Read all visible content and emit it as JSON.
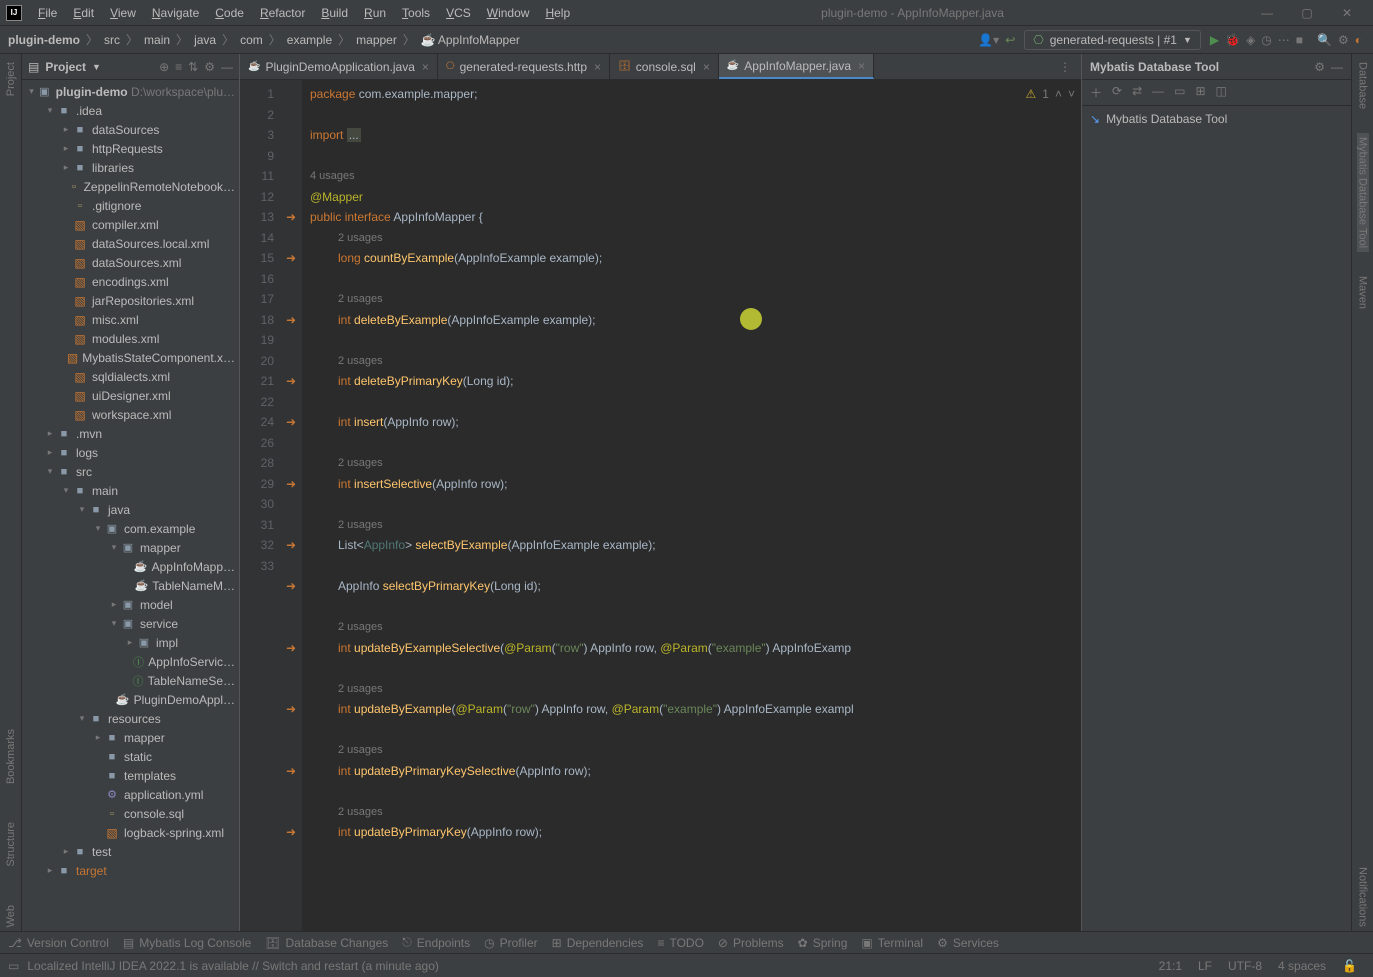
{
  "window": {
    "title": "plugin-demo - AppInfoMapper.java"
  },
  "menu": [
    "File",
    "Edit",
    "View",
    "Navigate",
    "Code",
    "Refactor",
    "Build",
    "Run",
    "Tools",
    "VCS",
    "Window",
    "Help"
  ],
  "breadcrumb": [
    "plugin-demo",
    "src",
    "main",
    "java",
    "com",
    "example",
    "mapper",
    "AppInfoMapper"
  ],
  "run_config": "generated-requests | #1",
  "project_panel": {
    "title": "Project"
  },
  "project": {
    "root": {
      "name": "plugin-demo",
      "path": "D:\\workspace\\plu…"
    },
    "nodes": [
      {
        "d": 1,
        "open": true,
        "ic": "folder",
        "name": ".idea"
      },
      {
        "d": 2,
        "open": false,
        "ic": "folder",
        "name": "dataSources"
      },
      {
        "d": 2,
        "open": false,
        "ic": "folder",
        "name": "httpRequests"
      },
      {
        "d": 2,
        "open": false,
        "ic": "folder",
        "name": "libraries"
      },
      {
        "d": 2,
        "ic": "file",
        "name": "ZeppelinRemoteNotebook…"
      },
      {
        "d": 2,
        "ic": "file",
        "name": ".gitignore"
      },
      {
        "d": 2,
        "ic": "xml",
        "name": "compiler.xml"
      },
      {
        "d": 2,
        "ic": "xml",
        "name": "dataSources.local.xml"
      },
      {
        "d": 2,
        "ic": "xml",
        "name": "dataSources.xml"
      },
      {
        "d": 2,
        "ic": "xml",
        "name": "encodings.xml"
      },
      {
        "d": 2,
        "ic": "xml",
        "name": "jarRepositories.xml"
      },
      {
        "d": 2,
        "ic": "xml",
        "name": "misc.xml"
      },
      {
        "d": 2,
        "ic": "xml",
        "name": "modules.xml"
      },
      {
        "d": 2,
        "ic": "xml",
        "name": "MybatisStateComponent.x…"
      },
      {
        "d": 2,
        "ic": "xml",
        "name": "sqldialects.xml"
      },
      {
        "d": 2,
        "ic": "xml",
        "name": "uiDesigner.xml"
      },
      {
        "d": 2,
        "ic": "xml",
        "name": "workspace.xml"
      },
      {
        "d": 1,
        "open": false,
        "ic": "folder",
        "name": ".mvn"
      },
      {
        "d": 1,
        "open": false,
        "ic": "folder",
        "name": "logs"
      },
      {
        "d": 1,
        "open": true,
        "ic": "folder",
        "name": "src"
      },
      {
        "d": 2,
        "open": true,
        "ic": "folder",
        "name": "main"
      },
      {
        "d": 3,
        "open": true,
        "ic": "folder",
        "name": "java"
      },
      {
        "d": 4,
        "open": true,
        "ic": "pkg",
        "name": "com.example"
      },
      {
        "d": 5,
        "open": true,
        "ic": "pkg",
        "name": "mapper"
      },
      {
        "d": 6,
        "ic": "java",
        "name": "AppInfoMapp…"
      },
      {
        "d": 6,
        "ic": "java",
        "name": "TableNameM…"
      },
      {
        "d": 5,
        "open": false,
        "ic": "pkg",
        "name": "model"
      },
      {
        "d": 5,
        "open": true,
        "ic": "pkg",
        "name": "service"
      },
      {
        "d": 6,
        "open": false,
        "ic": "pkg",
        "name": "impl"
      },
      {
        "d": 6,
        "ic": "class",
        "name": "AppInfoServic…"
      },
      {
        "d": 6,
        "ic": "class",
        "name": "TableNameSe…"
      },
      {
        "d": 5,
        "ic": "java",
        "name": "PluginDemoAppl…"
      },
      {
        "d": 3,
        "open": true,
        "ic": "folder",
        "name": "resources"
      },
      {
        "d": 4,
        "open": false,
        "ic": "folder",
        "name": "mapper"
      },
      {
        "d": 4,
        "ic": "folder",
        "name": "static"
      },
      {
        "d": 4,
        "ic": "folder",
        "name": "templates"
      },
      {
        "d": 4,
        "ic": "yml",
        "name": "application.yml"
      },
      {
        "d": 4,
        "ic": "file",
        "name": "console.sql"
      },
      {
        "d": 4,
        "ic": "xml",
        "name": "logback-spring.xml"
      },
      {
        "d": 2,
        "open": false,
        "ic": "folder",
        "name": "test"
      },
      {
        "d": 1,
        "open": false,
        "ic": "folder",
        "name": "target",
        "col": "#c57633"
      }
    ]
  },
  "tabs": [
    {
      "name": "PluginDemoApplication.java",
      "icon": "java"
    },
    {
      "name": "generated-requests.http",
      "icon": "http"
    },
    {
      "name": "console.sql",
      "icon": "sql"
    },
    {
      "name": "AppInfoMapper.java",
      "icon": "java",
      "active": true
    }
  ],
  "editor": {
    "warnings": "1",
    "line_numbers": [
      1,
      2,
      3,
      9,
      "",
      "",
      11,
      "",
      12,
      13,
      "",
      14,
      15,
      "",
      16,
      17,
      18,
      19,
      "",
      20,
      21,
      "",
      22,
      "",
      24,
      "",
      "",
      26,
      "",
      "",
      28,
      29,
      "",
      30,
      31,
      "",
      32,
      33
    ],
    "gutter_icons": {
      "11": "nav",
      "12": "nav",
      "14": "nav",
      "16": "nav",
      "18": "nav",
      "20": "nav",
      "22": "nav",
      "24": "nav",
      "26": "nav",
      "28": "nav",
      "30": "nav",
      "32": "nav"
    },
    "hints": {
      "u4": "4 usages",
      "u2": "2 usages"
    },
    "code": {
      "pkg": "package com.example.mapper;",
      "imp": "import ...",
      "ann": "@Mapper",
      "decl": "public interface AppInfoMapper {",
      "m1": "long countByExample(AppInfoExample example);",
      "m2": "int deleteByExample(AppInfoExample example);",
      "m3": "int deleteByPrimaryKey(Long id);",
      "m4": "int insert(AppInfo row);",
      "m5": "int insertSelective(AppInfo row);",
      "m6": "List<AppInfo> selectByExample(AppInfoExample example);",
      "m7": "AppInfo selectByPrimaryKey(Long id);",
      "m8": "int updateByExampleSelective(@Param(\"row\") AppInfo row, @Param(\"example\") AppInfoExamp",
      "m9": "int updateByExample(@Param(\"row\") AppInfo row, @Param(\"example\") AppInfoExample exampl",
      "m10": "int updateByPrimaryKeySelective(AppInfo row);",
      "m11": "int updateByPrimaryKey(AppInfo row);"
    }
  },
  "db_panel": {
    "title": "Mybatis Database Tool",
    "item": "Mybatis Database Tool"
  },
  "right_labels": [
    "Database",
    "Mybatis Database Tool",
    "Maven",
    "Notifications"
  ],
  "left_labels": [
    "Project",
    "Bookmarks",
    "Structure",
    "Web"
  ],
  "bottom": [
    "Version Control",
    "Mybatis Log Console",
    "Database Changes",
    "Endpoints",
    "Profiler",
    "Dependencies",
    "TODO",
    "Problems",
    "Spring",
    "Terminal",
    "Services"
  ],
  "status": {
    "msg": "Localized IntelliJ IDEA 2022.1 is available // Switch and restart (a minute ago)",
    "pos": "21:1",
    "lf": "LF",
    "enc": "UTF-8",
    "indent": "4 spaces"
  }
}
